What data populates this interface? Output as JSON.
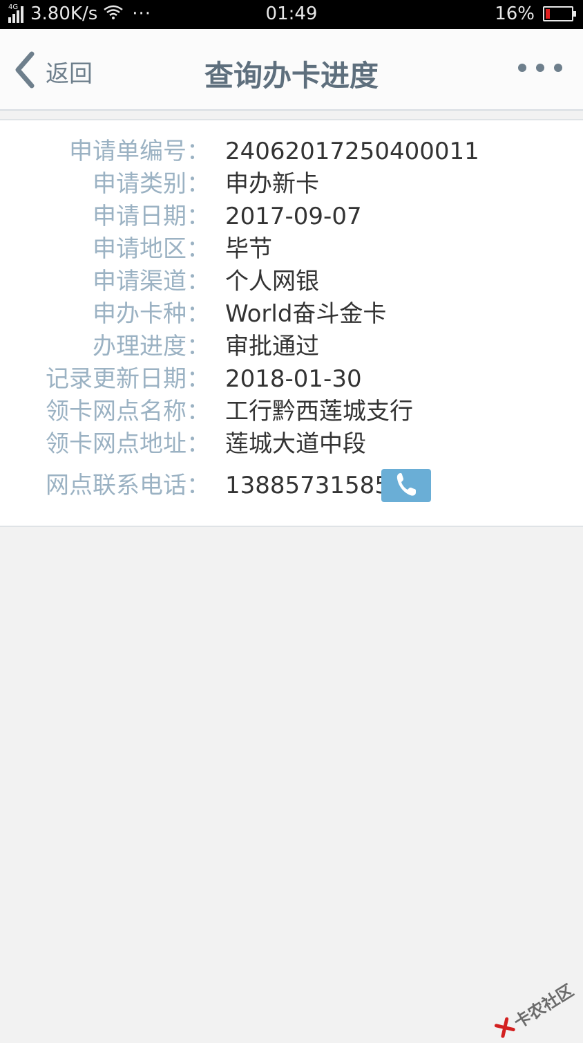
{
  "status_bar": {
    "network": "4G",
    "speed": "3.80K/s",
    "more": "···",
    "time": "01:49",
    "battery": "16%",
    "battery_level": 0.16
  },
  "header": {
    "back_label": "返回",
    "title": "查询办卡进度"
  },
  "details": [
    {
      "label": "申请单编号：",
      "value": "24062017250400011"
    },
    {
      "label": "申请类别：",
      "value": "申办新卡"
    },
    {
      "label": "申请日期：",
      "value": "2017-09-07"
    },
    {
      "label": "申请地区：",
      "value": "毕节"
    },
    {
      "label": "申请渠道：",
      "value": "个人网银"
    },
    {
      "label": "申办卡种：",
      "value": "World奋斗金卡"
    },
    {
      "label": "办理进度：",
      "value": "审批通过"
    },
    {
      "label": "记录更新日期：",
      "value": "2018-01-30"
    },
    {
      "label": "领卡网点名称：",
      "value": "工行黔西莲城支行"
    },
    {
      "label": "领卡网点地址：",
      "value": "莲城大道中段"
    },
    {
      "label": "网点联系电话：",
      "value": "13885731585"
    }
  ],
  "watermark": "卡农社区",
  "colors": {
    "label": "#9bb2c3",
    "value": "#333333",
    "title": "#5e6f7d",
    "phone_button": "#6aaed6",
    "battery_low": "#e02020"
  }
}
